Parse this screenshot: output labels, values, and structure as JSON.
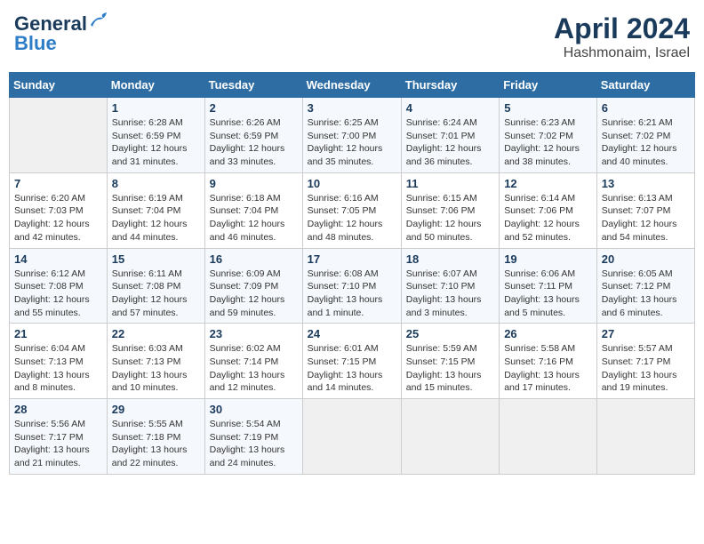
{
  "logo": {
    "line1": "General",
    "line2": "Blue",
    "bird_color": "#2e7ec7"
  },
  "title": "April 2024",
  "location": "Hashmonaim, Israel",
  "header_days": [
    "Sunday",
    "Monday",
    "Tuesday",
    "Wednesday",
    "Thursday",
    "Friday",
    "Saturday"
  ],
  "weeks": [
    [
      {
        "day": "",
        "info": ""
      },
      {
        "day": "1",
        "info": "Sunrise: 6:28 AM\nSunset: 6:59 PM\nDaylight: 12 hours\nand 31 minutes."
      },
      {
        "day": "2",
        "info": "Sunrise: 6:26 AM\nSunset: 6:59 PM\nDaylight: 12 hours\nand 33 minutes."
      },
      {
        "day": "3",
        "info": "Sunrise: 6:25 AM\nSunset: 7:00 PM\nDaylight: 12 hours\nand 35 minutes."
      },
      {
        "day": "4",
        "info": "Sunrise: 6:24 AM\nSunset: 7:01 PM\nDaylight: 12 hours\nand 36 minutes."
      },
      {
        "day": "5",
        "info": "Sunrise: 6:23 AM\nSunset: 7:02 PM\nDaylight: 12 hours\nand 38 minutes."
      },
      {
        "day": "6",
        "info": "Sunrise: 6:21 AM\nSunset: 7:02 PM\nDaylight: 12 hours\nand 40 minutes."
      }
    ],
    [
      {
        "day": "7",
        "info": "Sunrise: 6:20 AM\nSunset: 7:03 PM\nDaylight: 12 hours\nand 42 minutes."
      },
      {
        "day": "8",
        "info": "Sunrise: 6:19 AM\nSunset: 7:04 PM\nDaylight: 12 hours\nand 44 minutes."
      },
      {
        "day": "9",
        "info": "Sunrise: 6:18 AM\nSunset: 7:04 PM\nDaylight: 12 hours\nand 46 minutes."
      },
      {
        "day": "10",
        "info": "Sunrise: 6:16 AM\nSunset: 7:05 PM\nDaylight: 12 hours\nand 48 minutes."
      },
      {
        "day": "11",
        "info": "Sunrise: 6:15 AM\nSunset: 7:06 PM\nDaylight: 12 hours\nand 50 minutes."
      },
      {
        "day": "12",
        "info": "Sunrise: 6:14 AM\nSunset: 7:06 PM\nDaylight: 12 hours\nand 52 minutes."
      },
      {
        "day": "13",
        "info": "Sunrise: 6:13 AM\nSunset: 7:07 PM\nDaylight: 12 hours\nand 54 minutes."
      }
    ],
    [
      {
        "day": "14",
        "info": "Sunrise: 6:12 AM\nSunset: 7:08 PM\nDaylight: 12 hours\nand 55 minutes."
      },
      {
        "day": "15",
        "info": "Sunrise: 6:11 AM\nSunset: 7:08 PM\nDaylight: 12 hours\nand 57 minutes."
      },
      {
        "day": "16",
        "info": "Sunrise: 6:09 AM\nSunset: 7:09 PM\nDaylight: 12 hours\nand 59 minutes."
      },
      {
        "day": "17",
        "info": "Sunrise: 6:08 AM\nSunset: 7:10 PM\nDaylight: 13 hours\nand 1 minute."
      },
      {
        "day": "18",
        "info": "Sunrise: 6:07 AM\nSunset: 7:10 PM\nDaylight: 13 hours\nand 3 minutes."
      },
      {
        "day": "19",
        "info": "Sunrise: 6:06 AM\nSunset: 7:11 PM\nDaylight: 13 hours\nand 5 minutes."
      },
      {
        "day": "20",
        "info": "Sunrise: 6:05 AM\nSunset: 7:12 PM\nDaylight: 13 hours\nand 6 minutes."
      }
    ],
    [
      {
        "day": "21",
        "info": "Sunrise: 6:04 AM\nSunset: 7:13 PM\nDaylight: 13 hours\nand 8 minutes."
      },
      {
        "day": "22",
        "info": "Sunrise: 6:03 AM\nSunset: 7:13 PM\nDaylight: 13 hours\nand 10 minutes."
      },
      {
        "day": "23",
        "info": "Sunrise: 6:02 AM\nSunset: 7:14 PM\nDaylight: 13 hours\nand 12 minutes."
      },
      {
        "day": "24",
        "info": "Sunrise: 6:01 AM\nSunset: 7:15 PM\nDaylight: 13 hours\nand 14 minutes."
      },
      {
        "day": "25",
        "info": "Sunrise: 5:59 AM\nSunset: 7:15 PM\nDaylight: 13 hours\nand 15 minutes."
      },
      {
        "day": "26",
        "info": "Sunrise: 5:58 AM\nSunset: 7:16 PM\nDaylight: 13 hours\nand 17 minutes."
      },
      {
        "day": "27",
        "info": "Sunrise: 5:57 AM\nSunset: 7:17 PM\nDaylight: 13 hours\nand 19 minutes."
      }
    ],
    [
      {
        "day": "28",
        "info": "Sunrise: 5:56 AM\nSunset: 7:17 PM\nDaylight: 13 hours\nand 21 minutes."
      },
      {
        "day": "29",
        "info": "Sunrise: 5:55 AM\nSunset: 7:18 PM\nDaylight: 13 hours\nand 22 minutes."
      },
      {
        "day": "30",
        "info": "Sunrise: 5:54 AM\nSunset: 7:19 PM\nDaylight: 13 hours\nand 24 minutes."
      },
      {
        "day": "",
        "info": ""
      },
      {
        "day": "",
        "info": ""
      },
      {
        "day": "",
        "info": ""
      },
      {
        "day": "",
        "info": ""
      }
    ]
  ]
}
